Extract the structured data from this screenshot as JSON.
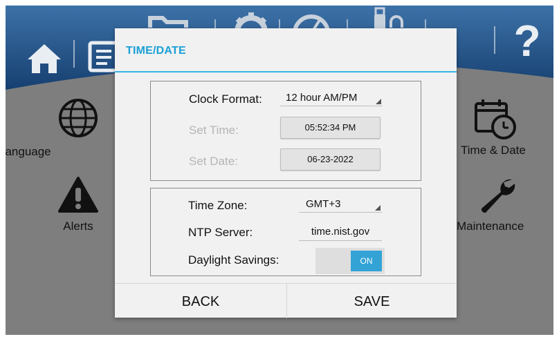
{
  "background": {
    "items": [
      {
        "id": "language",
        "label": "Language",
        "icon": "globe-icon"
      },
      {
        "id": "alerts",
        "label": "Alerts",
        "icon": "warning-icon"
      },
      {
        "id": "time_date",
        "label": "Time & Date",
        "icon": "calendar-clock-icon"
      },
      {
        "id": "maintenance",
        "label": "Maintenance",
        "icon": "wrench-icon"
      }
    ],
    "toolbar_icons": [
      "home-icon",
      "document-icon",
      "folder-icon",
      "gear-icon",
      "gauge-icon",
      "usb-lock-icon",
      "help-icon"
    ],
    "help_glyph": "?"
  },
  "dialog": {
    "title": "TIME/DATE",
    "clock_format": {
      "label": "Clock Format:",
      "value": "12 hour AM/PM"
    },
    "set_time": {
      "label": "Set Time:",
      "value": "05:52:34 PM"
    },
    "set_date": {
      "label": "Set Date:",
      "value": "06-23-2022"
    },
    "time_zone": {
      "label": "Time Zone:",
      "value": "GMT+3"
    },
    "ntp_server": {
      "label": "NTP Server:",
      "value": "time.nist.gov"
    },
    "daylight_savings": {
      "label": "Daylight Savings:",
      "state": "ON"
    },
    "back_label": "BACK",
    "save_label": "SAVE"
  },
  "colors": {
    "accent": "#33b5e5",
    "title": "#1a9fd6",
    "toolbar_wave": "#1f4f86",
    "toggle_on": "#33a3d6"
  }
}
